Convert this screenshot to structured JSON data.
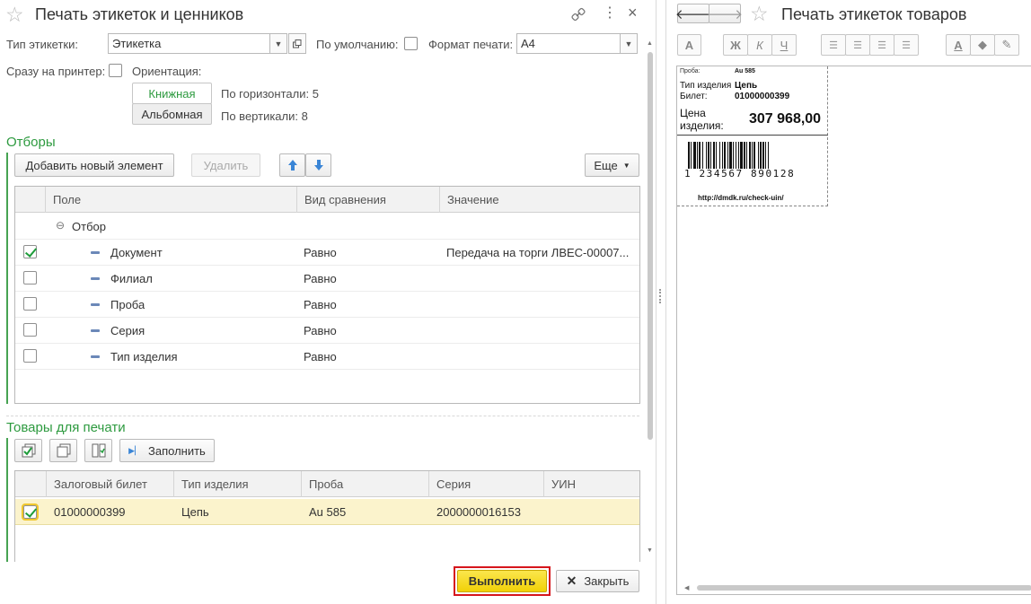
{
  "left": {
    "title": "Печать этикеток и ценников",
    "fields": {
      "label_type_caption": "Тип этикетки:",
      "label_type_value": "Этикетка",
      "default_caption": "По умолчанию:",
      "print_format_caption": "Формат печати:",
      "print_format_value": "А4",
      "to_printer_caption": "Сразу на принтер:",
      "orientation_caption": "Ориентация:",
      "orientation_portrait": "Книжная",
      "orientation_landscape": "Альбомная",
      "horizontal": "По горизонтали: 5",
      "vertical": "По вертикали: 8"
    },
    "filters": {
      "section_title": "Отборы",
      "add_button": "Добавить новый элемент",
      "delete_button": "Удалить",
      "more_button": "Еще",
      "columns": [
        "Поле",
        "Вид сравнения",
        "Значение"
      ],
      "group_label": "Отбор",
      "rows": [
        {
          "checked": true,
          "field": "Документ",
          "comparison": "Равно",
          "value": "Передача на торги ЛВЕС-00007..."
        },
        {
          "checked": false,
          "field": "Филиал",
          "comparison": "Равно",
          "value": ""
        },
        {
          "checked": false,
          "field": "Проба",
          "comparison": "Равно",
          "value": ""
        },
        {
          "checked": false,
          "field": "Серия",
          "comparison": "Равно",
          "value": ""
        },
        {
          "checked": false,
          "field": "Тип изделия",
          "comparison": "Равно",
          "value": ""
        }
      ]
    },
    "goods": {
      "section_title": "Товары для печати",
      "fill_button": "Заполнить",
      "columns": [
        "Залоговый билет",
        "Тип изделия",
        "Проба",
        "Серия",
        "УИН"
      ],
      "rows": [
        {
          "checked": true,
          "ticket": "01000000399",
          "type": "Цепь",
          "probe": "Au 585",
          "series": "2000000016153",
          "uin": ""
        }
      ]
    },
    "execute_button": "Выполнить",
    "close_button": "Закрыть"
  },
  "right": {
    "title": "Печать этикеток товаров",
    "format_buttons": [
      "A",
      "Ж",
      "К",
      "Ч"
    ],
    "label": {
      "probe_caption": "Проба:",
      "probe_value": "Au 585",
      "type_caption": "Тип изделия",
      "type_value": "Цепь",
      "ticket_caption": "Билет:",
      "ticket_value": "01000000399",
      "price_caption_1": "Цена",
      "price_caption_2": "изделия:",
      "price_value": "307 968,00",
      "barcode_digits": "1 234567 890128",
      "url": "http://dmdk.ru/check-uin/"
    }
  },
  "colors": {
    "accent_green": "#2d9a3f",
    "execute_yellow": "#f5d80f",
    "execute_border": "#d6161c",
    "selected_row": "#fbf3cc"
  }
}
